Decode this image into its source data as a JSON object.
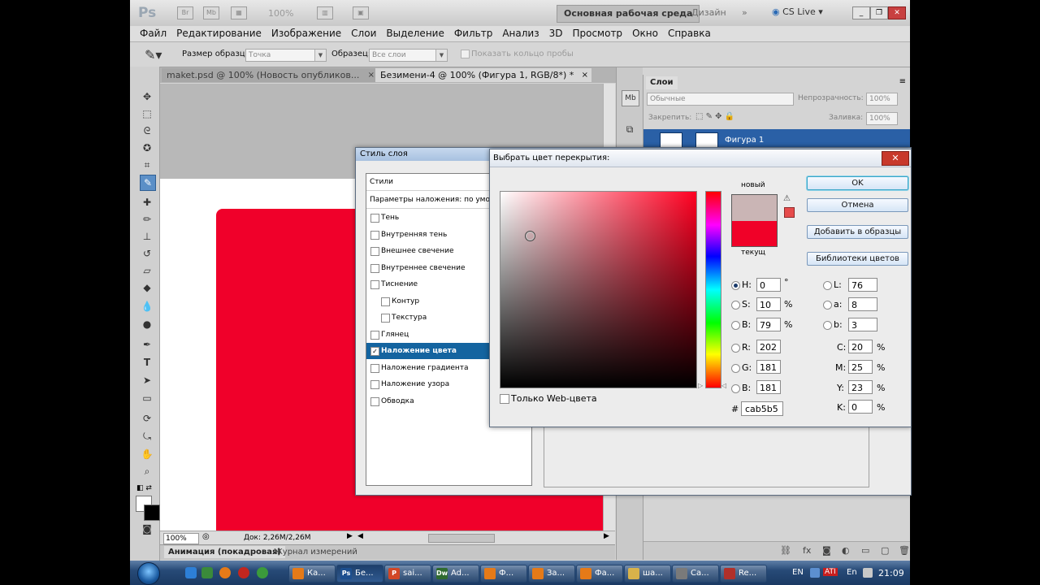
{
  "appbar": {
    "logo": "Ps",
    "br_icon": "Br",
    "mb_icon": "Mb",
    "zoom": "100%",
    "workspace_main": "Основная рабочая среда",
    "workspace_design": "Дизайн",
    "more": "»",
    "cslive": "CS Live"
  },
  "menu": [
    "Файл",
    "Редактирование",
    "Изображение",
    "Слои",
    "Выделение",
    "Фильтр",
    "Анализ",
    "3D",
    "Просмотр",
    "Окно",
    "Справка"
  ],
  "options": {
    "sample_size_label": "Размер образца:",
    "sample_size_value": "Точка",
    "sample_label": "Образец:",
    "sample_value": "Все слои",
    "show_ring_label": "Показать кольцо пробы"
  },
  "tabs": {
    "tab1": "maket.psd @ 100% (Новость опубликов...",
    "tab2": "Безимени-4 @ 100% (Фигура 1, RGB/8*) *",
    "close": "×"
  },
  "status": {
    "zoom": "100%",
    "doc": "Док: 2,26M/2,26M"
  },
  "bottom_tabs": {
    "animation": "Анимация (покадровая)",
    "measure": "Журнал измерений"
  },
  "layers": {
    "title": "Слои",
    "blend_mode": "Обычные",
    "opacity_label": "Непрозрачность:",
    "opacity_value": "100%",
    "lock_label": "Закрепить:",
    "fill_label": "Заливка:",
    "fill_value": "100%",
    "layer_name": "Фигура 1"
  },
  "layer_style": {
    "title": "Стиль слоя",
    "styles_header": "Стили",
    "blend_options": "Параметры наложения: по умолч",
    "items": [
      {
        "label": "Тень",
        "checked": false,
        "indent": false
      },
      {
        "label": "Внутренняя тень",
        "checked": false,
        "indent": false
      },
      {
        "label": "Внешнее свечение",
        "checked": false,
        "indent": false
      },
      {
        "label": "Внутреннее свечение",
        "checked": false,
        "indent": false
      },
      {
        "label": "Тиснение",
        "checked": false,
        "indent": false
      },
      {
        "label": "Контур",
        "checked": false,
        "indent": true
      },
      {
        "label": "Текстура",
        "checked": false,
        "indent": true
      },
      {
        "label": "Глянец",
        "checked": false,
        "indent": false
      },
      {
        "label": "Наложение цвета",
        "checked": true,
        "indent": false
      },
      {
        "label": "Наложение градиента",
        "checked": false,
        "indent": false
      },
      {
        "label": "Наложение узора",
        "checked": false,
        "indent": false
      },
      {
        "label": "Обводка",
        "checked": false,
        "indent": false
      }
    ]
  },
  "picker": {
    "title": "Выбрать цвет перекрытия:",
    "close": "✕",
    "new_label": "новый",
    "current_label": "текущ",
    "new_color": "#cab5b5",
    "current_color": "#f00128",
    "ok": "OK",
    "cancel": "Отмена",
    "add_swatch": "Добавить в образцы",
    "libraries": "Библиотеки цветов",
    "web_only": "Только Web-цвета",
    "H": {
      "label": "H:",
      "value": "0",
      "unit": "°"
    },
    "S": {
      "label": "S:",
      "value": "10",
      "unit": "%"
    },
    "Bv": {
      "label": "B:",
      "value": "79",
      "unit": "%"
    },
    "R": {
      "label": "R:",
      "value": "202"
    },
    "G": {
      "label": "G:",
      "value": "181"
    },
    "Bb": {
      "label": "B:",
      "value": "181"
    },
    "L": {
      "label": "L:",
      "value": "76"
    },
    "a": {
      "label": "a:",
      "value": "8"
    },
    "b": {
      "label": "b:",
      "value": "3"
    },
    "C": {
      "label": "C:",
      "value": "20",
      "unit": "%"
    },
    "M": {
      "label": "M:",
      "value": "25",
      "unit": "%"
    },
    "Y": {
      "label": "Y:",
      "value": "23",
      "unit": "%"
    },
    "K": {
      "label": "K:",
      "value": "0",
      "unit": "%"
    },
    "hex_sign": "#",
    "hex": "cab5b5"
  },
  "taskbar": {
    "buttons": [
      {
        "icon": "firefox-icon",
        "label": "Ка..."
      },
      {
        "icon": "photoshop-icon",
        "label": "Бе..."
      },
      {
        "icon": "powerpoint-icon",
        "label": "sai..."
      },
      {
        "icon": "dreamweaver-icon",
        "label": "Ad..."
      },
      {
        "icon": "firefox-icon",
        "label": "Ф..."
      },
      {
        "icon": "firefox-icon",
        "label": "За..."
      },
      {
        "icon": "firefox-icon",
        "label": "Фа..."
      },
      {
        "icon": "folder-icon",
        "label": "ша..."
      },
      {
        "icon": "app-icon",
        "label": "Са..."
      },
      {
        "icon": "recorder-icon",
        "label": "Re..."
      }
    ],
    "lang": "EN",
    "ati": "ATI",
    "lang2": "En",
    "time": "21:09"
  }
}
